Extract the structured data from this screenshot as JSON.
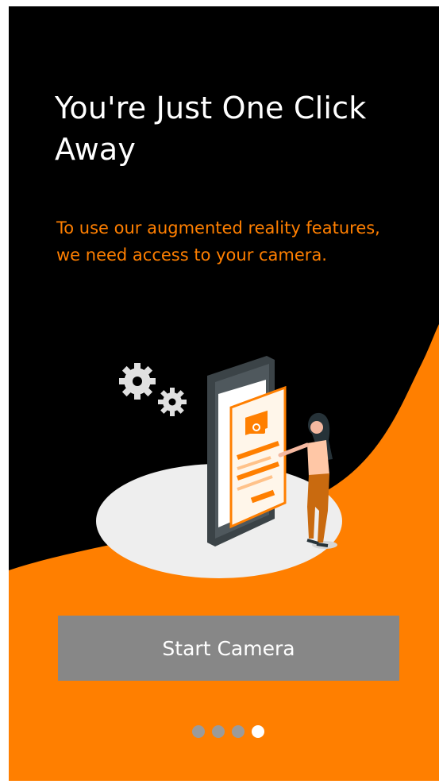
{
  "onboarding": {
    "title": "You're Just One Click Away",
    "description": "To use our augmented reality features, we need access to your camera.",
    "start_label": "Start Camera"
  },
  "pager": {
    "total": 4,
    "active_index": 3
  },
  "colors": {
    "background": "#000000",
    "accent": "#ff7f00",
    "button": "#878787",
    "text": "#ffffff",
    "dot_inactive": "#9b9b9b",
    "dot_active": "#ffffff"
  },
  "icons": [
    "gear-icon",
    "camera-icon",
    "phone-icon"
  ]
}
